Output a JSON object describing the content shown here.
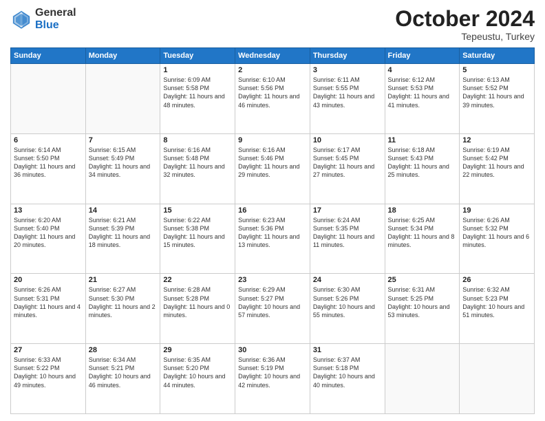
{
  "logo": {
    "general": "General",
    "blue": "Blue"
  },
  "title": "October 2024",
  "subtitle": "Tepeustu, Turkey",
  "days_of_week": [
    "Sunday",
    "Monday",
    "Tuesday",
    "Wednesday",
    "Thursday",
    "Friday",
    "Saturday"
  ],
  "weeks": [
    [
      {
        "day": "",
        "sunrise": "",
        "sunset": "",
        "daylight": ""
      },
      {
        "day": "",
        "sunrise": "",
        "sunset": "",
        "daylight": ""
      },
      {
        "day": "1",
        "sunrise": "Sunrise: 6:09 AM",
        "sunset": "Sunset: 5:58 PM",
        "daylight": "Daylight: 11 hours and 48 minutes."
      },
      {
        "day": "2",
        "sunrise": "Sunrise: 6:10 AM",
        "sunset": "Sunset: 5:56 PM",
        "daylight": "Daylight: 11 hours and 46 minutes."
      },
      {
        "day": "3",
        "sunrise": "Sunrise: 6:11 AM",
        "sunset": "Sunset: 5:55 PM",
        "daylight": "Daylight: 11 hours and 43 minutes."
      },
      {
        "day": "4",
        "sunrise": "Sunrise: 6:12 AM",
        "sunset": "Sunset: 5:53 PM",
        "daylight": "Daylight: 11 hours and 41 minutes."
      },
      {
        "day": "5",
        "sunrise": "Sunrise: 6:13 AM",
        "sunset": "Sunset: 5:52 PM",
        "daylight": "Daylight: 11 hours and 39 minutes."
      }
    ],
    [
      {
        "day": "6",
        "sunrise": "Sunrise: 6:14 AM",
        "sunset": "Sunset: 5:50 PM",
        "daylight": "Daylight: 11 hours and 36 minutes."
      },
      {
        "day": "7",
        "sunrise": "Sunrise: 6:15 AM",
        "sunset": "Sunset: 5:49 PM",
        "daylight": "Daylight: 11 hours and 34 minutes."
      },
      {
        "day": "8",
        "sunrise": "Sunrise: 6:16 AM",
        "sunset": "Sunset: 5:48 PM",
        "daylight": "Daylight: 11 hours and 32 minutes."
      },
      {
        "day": "9",
        "sunrise": "Sunrise: 6:16 AM",
        "sunset": "Sunset: 5:46 PM",
        "daylight": "Daylight: 11 hours and 29 minutes."
      },
      {
        "day": "10",
        "sunrise": "Sunrise: 6:17 AM",
        "sunset": "Sunset: 5:45 PM",
        "daylight": "Daylight: 11 hours and 27 minutes."
      },
      {
        "day": "11",
        "sunrise": "Sunrise: 6:18 AM",
        "sunset": "Sunset: 5:43 PM",
        "daylight": "Daylight: 11 hours and 25 minutes."
      },
      {
        "day": "12",
        "sunrise": "Sunrise: 6:19 AM",
        "sunset": "Sunset: 5:42 PM",
        "daylight": "Daylight: 11 hours and 22 minutes."
      }
    ],
    [
      {
        "day": "13",
        "sunrise": "Sunrise: 6:20 AM",
        "sunset": "Sunset: 5:40 PM",
        "daylight": "Daylight: 11 hours and 20 minutes."
      },
      {
        "day": "14",
        "sunrise": "Sunrise: 6:21 AM",
        "sunset": "Sunset: 5:39 PM",
        "daylight": "Daylight: 11 hours and 18 minutes."
      },
      {
        "day": "15",
        "sunrise": "Sunrise: 6:22 AM",
        "sunset": "Sunset: 5:38 PM",
        "daylight": "Daylight: 11 hours and 15 minutes."
      },
      {
        "day": "16",
        "sunrise": "Sunrise: 6:23 AM",
        "sunset": "Sunset: 5:36 PM",
        "daylight": "Daylight: 11 hours and 13 minutes."
      },
      {
        "day": "17",
        "sunrise": "Sunrise: 6:24 AM",
        "sunset": "Sunset: 5:35 PM",
        "daylight": "Daylight: 11 hours and 11 minutes."
      },
      {
        "day": "18",
        "sunrise": "Sunrise: 6:25 AM",
        "sunset": "Sunset: 5:34 PM",
        "daylight": "Daylight: 11 hours and 8 minutes."
      },
      {
        "day": "19",
        "sunrise": "Sunrise: 6:26 AM",
        "sunset": "Sunset: 5:32 PM",
        "daylight": "Daylight: 11 hours and 6 minutes."
      }
    ],
    [
      {
        "day": "20",
        "sunrise": "Sunrise: 6:26 AM",
        "sunset": "Sunset: 5:31 PM",
        "daylight": "Daylight: 11 hours and 4 minutes."
      },
      {
        "day": "21",
        "sunrise": "Sunrise: 6:27 AM",
        "sunset": "Sunset: 5:30 PM",
        "daylight": "Daylight: 11 hours and 2 minutes."
      },
      {
        "day": "22",
        "sunrise": "Sunrise: 6:28 AM",
        "sunset": "Sunset: 5:28 PM",
        "daylight": "Daylight: 11 hours and 0 minutes."
      },
      {
        "day": "23",
        "sunrise": "Sunrise: 6:29 AM",
        "sunset": "Sunset: 5:27 PM",
        "daylight": "Daylight: 10 hours and 57 minutes."
      },
      {
        "day": "24",
        "sunrise": "Sunrise: 6:30 AM",
        "sunset": "Sunset: 5:26 PM",
        "daylight": "Daylight: 10 hours and 55 minutes."
      },
      {
        "day": "25",
        "sunrise": "Sunrise: 6:31 AM",
        "sunset": "Sunset: 5:25 PM",
        "daylight": "Daylight: 10 hours and 53 minutes."
      },
      {
        "day": "26",
        "sunrise": "Sunrise: 6:32 AM",
        "sunset": "Sunset: 5:23 PM",
        "daylight": "Daylight: 10 hours and 51 minutes."
      }
    ],
    [
      {
        "day": "27",
        "sunrise": "Sunrise: 6:33 AM",
        "sunset": "Sunset: 5:22 PM",
        "daylight": "Daylight: 10 hours and 49 minutes."
      },
      {
        "day": "28",
        "sunrise": "Sunrise: 6:34 AM",
        "sunset": "Sunset: 5:21 PM",
        "daylight": "Daylight: 10 hours and 46 minutes."
      },
      {
        "day": "29",
        "sunrise": "Sunrise: 6:35 AM",
        "sunset": "Sunset: 5:20 PM",
        "daylight": "Daylight: 10 hours and 44 minutes."
      },
      {
        "day": "30",
        "sunrise": "Sunrise: 6:36 AM",
        "sunset": "Sunset: 5:19 PM",
        "daylight": "Daylight: 10 hours and 42 minutes."
      },
      {
        "day": "31",
        "sunrise": "Sunrise: 6:37 AM",
        "sunset": "Sunset: 5:18 PM",
        "daylight": "Daylight: 10 hours and 40 minutes."
      },
      {
        "day": "",
        "sunrise": "",
        "sunset": "",
        "daylight": ""
      },
      {
        "day": "",
        "sunrise": "",
        "sunset": "",
        "daylight": ""
      }
    ]
  ]
}
